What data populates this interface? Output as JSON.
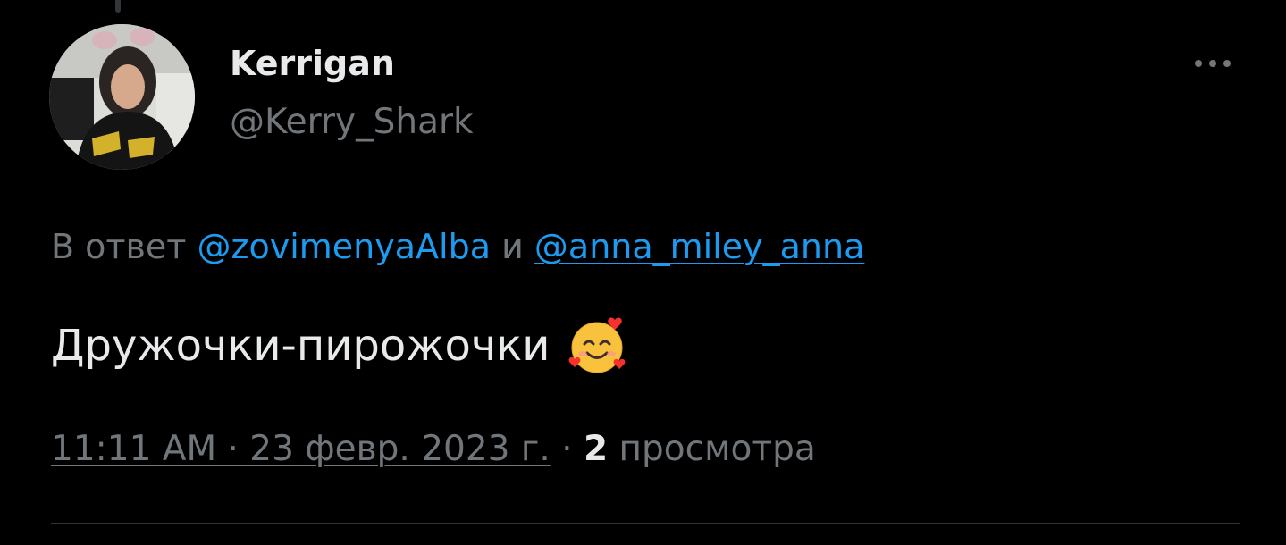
{
  "colors": {
    "background": "#000000",
    "primary_text": "#e7e9ea",
    "secondary_text": "#71767b",
    "link": "#1d9bf0",
    "divider": "#2f3336"
  },
  "author": {
    "display_name": "Kerrigan",
    "handle": "@Kerry_Shark",
    "avatar_icon": "profile-photo"
  },
  "more_icon": "more-dots-icon",
  "reply_context": {
    "prefix": "В ответ",
    "mention_1": "@zovimenyaAlba",
    "conjunction": "и",
    "mention_2": "@anna_miley_anna"
  },
  "tweet": {
    "text": "Дружочки-пирожочки",
    "emoji": "smiling-face-with-hearts-emoji"
  },
  "meta": {
    "timestamp": "11:11 AM · 23 февр. 2023 г.",
    "separator": "·",
    "views_count": "2",
    "views_label": "просмотра"
  }
}
